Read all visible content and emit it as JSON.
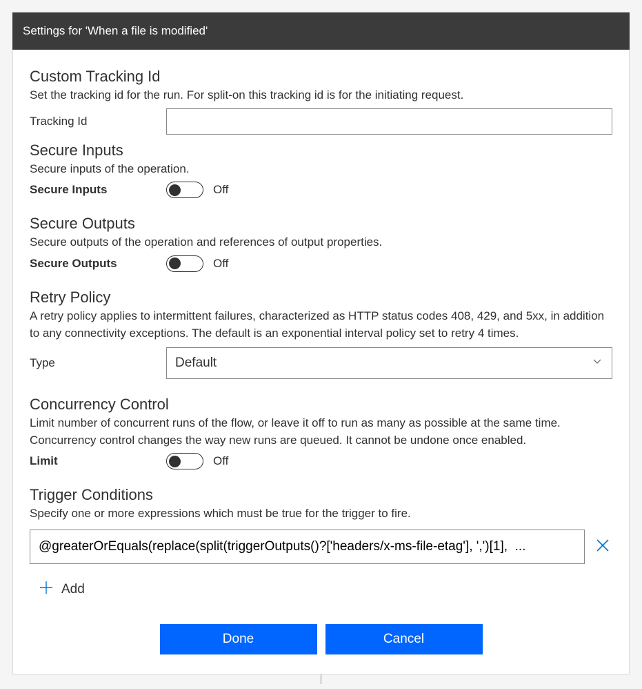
{
  "header": {
    "title": "Settings for 'When a file is modified'"
  },
  "sections": {
    "tracking": {
      "title": "Custom Tracking Id",
      "desc": "Set the tracking id for the run. For split-on this tracking id is for the initiating request.",
      "field_label": "Tracking Id",
      "value": ""
    },
    "secure_inputs": {
      "title": "Secure Inputs",
      "desc": "Secure inputs of the operation.",
      "field_label": "Secure Inputs",
      "state": "Off"
    },
    "secure_outputs": {
      "title": "Secure Outputs",
      "desc": "Secure outputs of the operation and references of output properties.",
      "field_label": "Secure Outputs",
      "state": "Off"
    },
    "retry": {
      "title": "Retry Policy",
      "desc": "A retry policy applies to intermittent failures, characterized as HTTP status codes 408, 429, and 5xx, in addition to any connectivity exceptions. The default is an exponential interval policy set to retry 4 times.",
      "field_label": "Type",
      "selected": "Default"
    },
    "concurrency": {
      "title": "Concurrency Control",
      "desc": "Limit number of concurrent runs of the flow, or leave it off to run as many as possible at the same time. Concurrency control changes the way new runs are queued. It cannot be undone once enabled.",
      "field_label": "Limit",
      "state": "Off"
    },
    "trigger_conditions": {
      "title": "Trigger Conditions",
      "desc": "Specify one or more expressions which must be true for the trigger to fire.",
      "condition_value": "@greaterOrEquals(replace(split(triggerOutputs()?['headers/x-ms-file-etag'], ',')[1],  ...",
      "add_label": "Add"
    }
  },
  "footer": {
    "done_label": "Done",
    "cancel_label": "Cancel"
  }
}
